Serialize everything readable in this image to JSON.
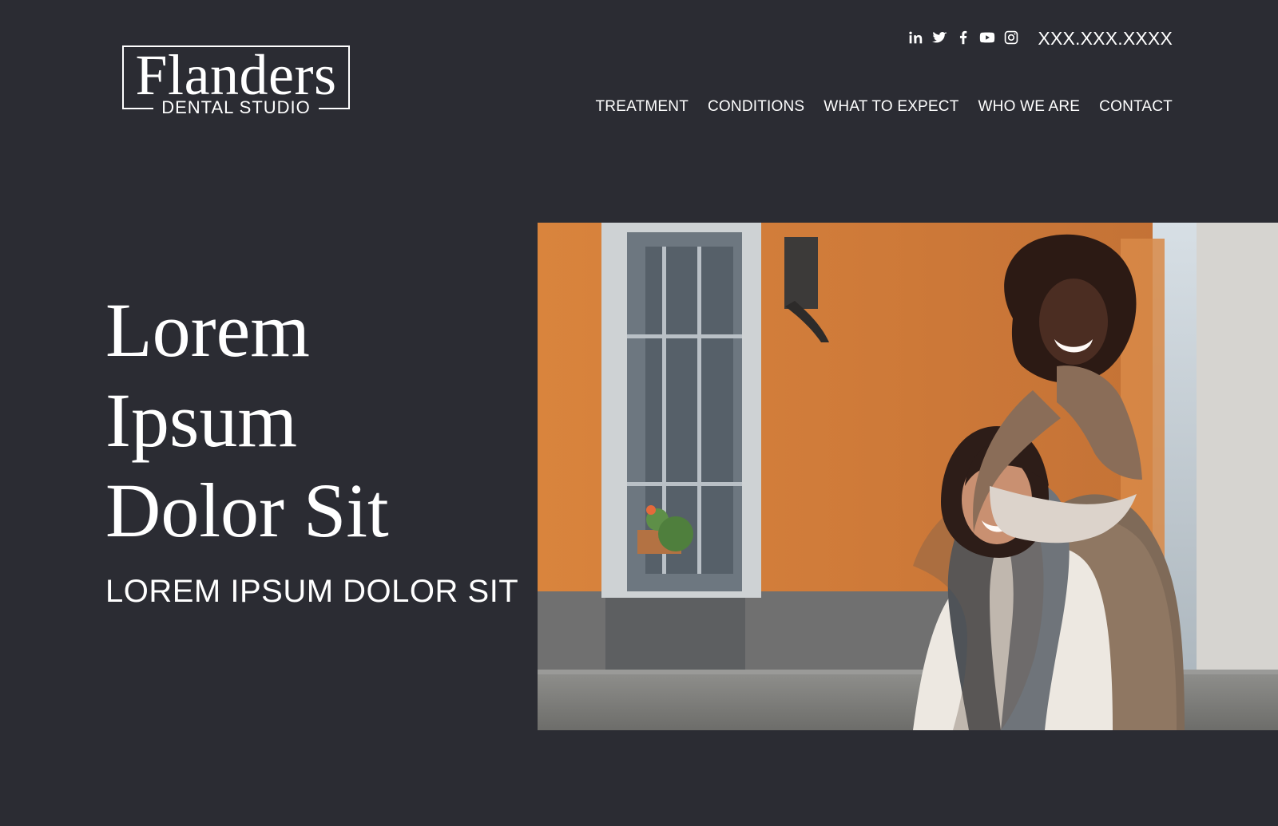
{
  "logo": {
    "main": "Flanders",
    "sub": "DENTAL STUDIO"
  },
  "social": {
    "items": [
      "linkedin-icon",
      "twitter-icon",
      "facebook-icon",
      "youtube-icon",
      "instagram-icon"
    ]
  },
  "header": {
    "phone": "XXX.XXX.XXXX"
  },
  "nav": {
    "items": [
      {
        "label": "TREATMENT"
      },
      {
        "label": "CONDITIONS"
      },
      {
        "label": "WHAT TO EXPECT"
      },
      {
        "label": "WHO WE ARE"
      },
      {
        "label": "CONTACT"
      }
    ]
  },
  "hero": {
    "headline_lines": [
      "Lorem",
      "Ipsum",
      "Dolor Sit"
    ],
    "subheadline": "LOREM IPSUM DOLOR SIT"
  },
  "colors": {
    "background": "#2b2c33",
    "text": "#ffffff",
    "accent_orange": "#d8863f"
  }
}
